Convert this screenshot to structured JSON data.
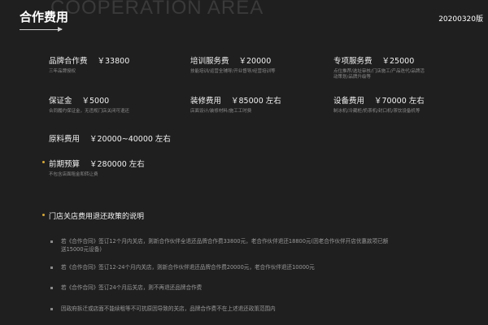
{
  "header": {
    "background_word": "COOPERATION AREA",
    "title": "合作费用",
    "version": "20200320版"
  },
  "fees": [
    {
      "name": "品牌合作费",
      "amount": "￥33800",
      "desc": "三年品牌授权"
    },
    {
      "name": "培训服务费",
      "amount": "￥20000",
      "desc": "技能培训/运营全辅导/开业督导/经营培训等"
    },
    {
      "name": "专项服务费",
      "amount": "￥25000",
      "desc": "点位推荐/选址审核/门店施工/产品迭代/品牌活\n动策划/品牌升级等"
    },
    {
      "name": "保证金",
      "amount": "￥5000",
      "desc": "合同履约保证金，无违规门店关闭可退还"
    },
    {
      "name": "装修费用",
      "amount": "￥85000 左右",
      "desc": "店面设计/装修材料/施工工时费"
    },
    {
      "name": "设备费用",
      "amount": "￥70000 左右",
      "desc": "制冰机/冷藏柜/奶茶机/封口机/茶饮设备机等"
    },
    {
      "name": "原料费用",
      "amount": "￥20000~40000 左右",
      "desc": ""
    },
    {
      "name": "前期预算",
      "amount": "￥280000 左右",
      "desc": "不包含店面租金和转让费"
    }
  ],
  "policy": {
    "title": "门店关店费用退还政策的说明",
    "items": [
      "若《合作合同》签订12个月内关店，则新合作伙伴全退还品牌合作费33800元，老合作伙伴退还18800元(因老合作伙伴开店优惠款项已额\n送15000元设备)",
      "若《合作合同》签订12-24个月内关店，则新合作伙伴退还品牌合作费20000元，老合作伙伴退还10000元",
      "若《合作合同》签订24个月后关店，则不再退还品牌合作费",
      "因政府拆迁或店面不能续租等不可抗原因导致的关店，品牌合作费不在上述退还政策范围内"
    ]
  },
  "colors": {
    "background": "#1f1f1f",
    "accent_bullet": "#d6a93c"
  }
}
